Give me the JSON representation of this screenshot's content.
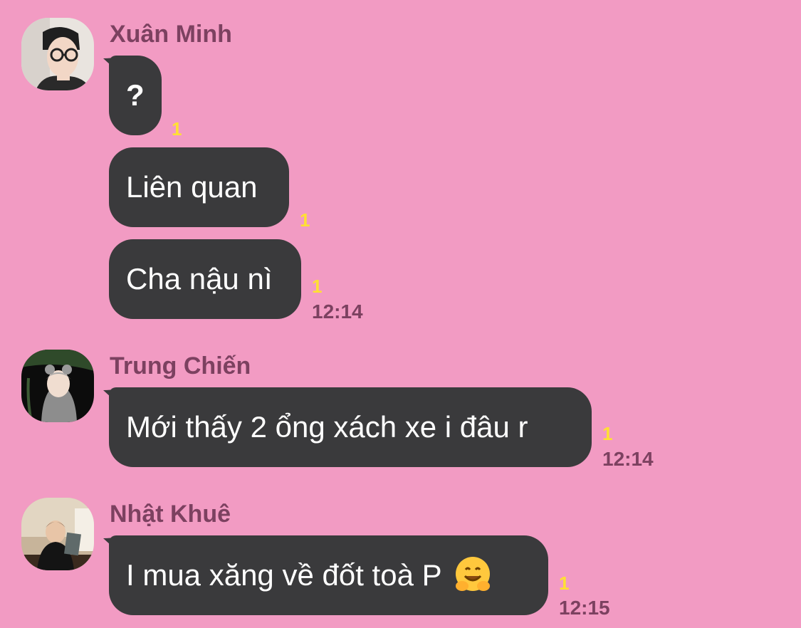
{
  "messages_group_1": {
    "sender": "Xuân Minh",
    "bubbles": [
      "?",
      "Liên quan",
      "Cha nậu nì"
    ],
    "unread": [
      "1",
      "1",
      "1"
    ],
    "time": "12:14",
    "avatar_icon": "avatar-man-glasses"
  },
  "messages_group_2": {
    "sender": "Trung Chiến",
    "bubbles": [
      "Mới thấy 2 ổng xách xe i đâu r"
    ],
    "unread": [
      "1"
    ],
    "time": "12:14",
    "avatar_icon": "avatar-man-hoodie"
  },
  "messages_group_3": {
    "sender": "Nhật Khuê",
    "bubbles": [
      "I mua xăng về đốt toà P"
    ],
    "emoji": "hugging-face-emoji",
    "unread": [
      "1"
    ],
    "time": "12:15",
    "avatar_icon": "avatar-man-reading"
  },
  "colors": {
    "background": "#f29bc3",
    "bubble": "#3a3a3c",
    "unread": "#ffe033",
    "meta_text": "#7c4160"
  }
}
